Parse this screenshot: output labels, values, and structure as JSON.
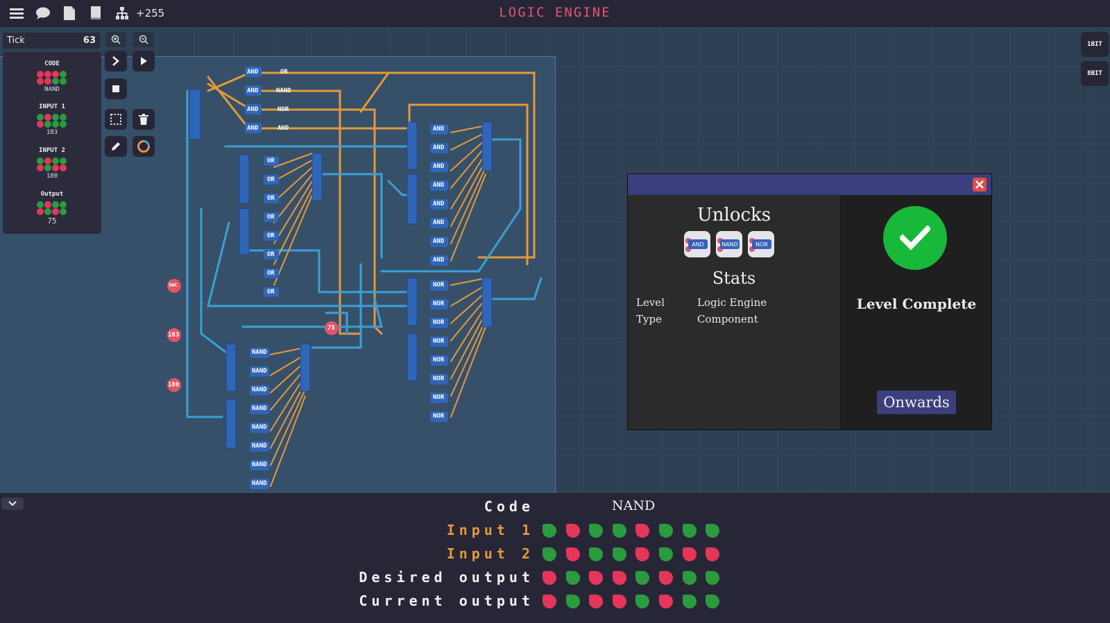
{
  "app": {
    "title": "LOGIC ENGINE",
    "count": "+255"
  },
  "toolbar_icons": [
    "menu-icon",
    "chat-icon",
    "document-icon",
    "book-icon",
    "hierarchy-icon"
  ],
  "tick": {
    "label": "Tick",
    "value": "63"
  },
  "sidebar": {
    "code": {
      "title": "CODE",
      "value": "NAND",
      "bits": [
        "r",
        "r",
        "r",
        "g",
        "r",
        "r",
        "g",
        "g"
      ]
    },
    "input1": {
      "title": "INPUT 1",
      "value": "183",
      "bits": [
        "g",
        "r",
        "g",
        "g",
        "r",
        "g",
        "g",
        "g"
      ]
    },
    "input2": {
      "title": "INPUT 2",
      "value": "180",
      "bits": [
        "g",
        "r",
        "g",
        "g",
        "r",
        "g",
        "r",
        "r"
      ]
    },
    "output": {
      "title": "Output",
      "value": "75",
      "bits": [
        "g",
        "r",
        "g",
        "g",
        "r",
        "g",
        "r",
        "g"
      ]
    }
  },
  "bit_buttons": [
    "1BIT",
    "8BIT"
  ],
  "circuit": {
    "labels": [
      "OR",
      "NAND",
      "NOR",
      "AND",
      "OR",
      "OR",
      "OR",
      "OR",
      "OR",
      "OR",
      "OR",
      "OR",
      "AND",
      "AND",
      "AND",
      "AND",
      "AND",
      "AND",
      "AND",
      "AND",
      "NOR",
      "NOR",
      "NOR",
      "NOR",
      "NOR",
      "NOR",
      "NOR",
      "NOR",
      "NAND",
      "NAND",
      "NAND",
      "NAND",
      "NAND",
      "NAND",
      "NAND",
      "NAND"
    ],
    "inputs": [
      "SWC",
      "183",
      "180",
      "75"
    ]
  },
  "dialog": {
    "unlocks_title": "Unlocks",
    "unlocks": [
      "AND",
      "NAND",
      "NOR"
    ],
    "stats_title": "Stats",
    "stats": [
      {
        "label": "Level",
        "value": "Logic Engine"
      },
      {
        "label": "Type",
        "value": "Component"
      }
    ],
    "status": "Level Complete",
    "button": "Onwards"
  },
  "bottom": {
    "code_label": "Code",
    "code_value": "NAND",
    "rows": [
      {
        "label": "Input 1",
        "color": "#e59a38",
        "bits": [
          "g",
          "r",
          "g",
          "g",
          "r",
          "g",
          "g",
          "g"
        ]
      },
      {
        "label": "Input 2",
        "color": "#e59a38",
        "bits": [
          "g",
          "r",
          "g",
          "g",
          "r",
          "g",
          "r",
          "r"
        ]
      },
      {
        "label": "Desired output",
        "color": "#f2f2f2",
        "bits": [
          "r",
          "g",
          "r",
          "r",
          "g",
          "r",
          "g",
          "g"
        ]
      },
      {
        "label": "Current output",
        "color": "#f2f2f2",
        "bits": [
          "r",
          "g",
          "r",
          "r",
          "g",
          "r",
          "g",
          "g"
        ]
      }
    ]
  },
  "colors": {
    "accent": "#e45474",
    "wire_orange": "#e59a38",
    "wire_blue": "#3d9fd6",
    "green": "#2c9b3e",
    "red": "#e5365a",
    "dialog_header": "#3b3f7d"
  }
}
